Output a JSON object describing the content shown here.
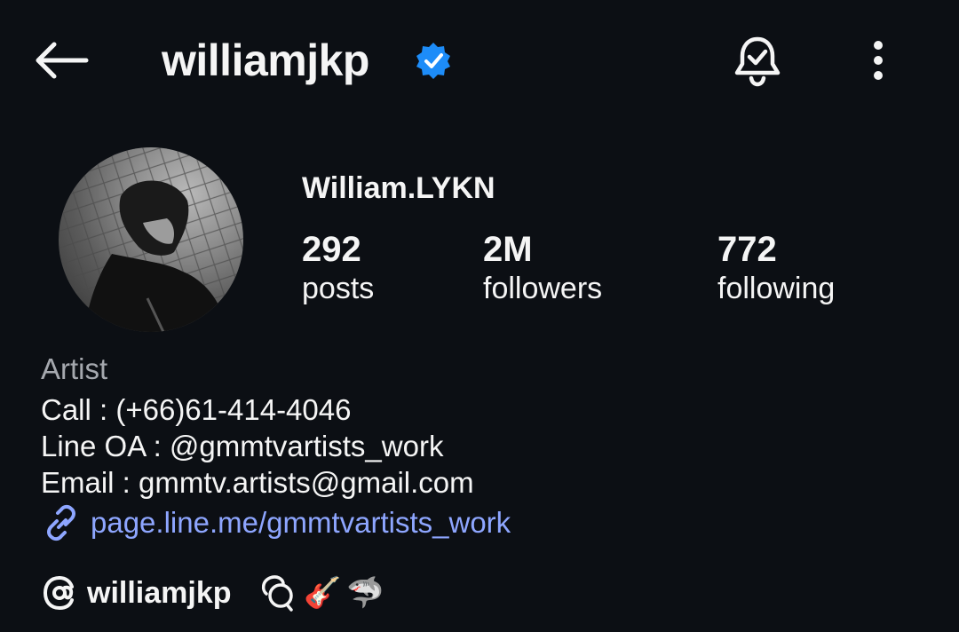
{
  "header": {
    "username": "williamjkp",
    "back_icon": "arrow-left-icon",
    "verified_icon": "verified-badge-icon",
    "notification_icon": "bell-check-icon",
    "menu_icon": "vertical-ellipsis-icon"
  },
  "profile": {
    "display_name": "William.LYKN",
    "stats": {
      "posts": {
        "value": "292",
        "label": "posts"
      },
      "followers": {
        "value": "2M",
        "label": "followers"
      },
      "following": {
        "value": "772",
        "label": "following"
      }
    }
  },
  "bio": {
    "category": "Artist",
    "lines": [
      "Call : (+66)61-414-4046",
      "Line OA : @gmmtvartists_work",
      "Email : gmmtv.artists@gmail.com"
    ],
    "link": "page.line.me/gmmtvartists_work"
  },
  "threads": {
    "username": "williamjkp",
    "emojis": [
      "🎸",
      "🦈"
    ]
  },
  "colors": {
    "background": "#0c0f14",
    "text": "#f5f5f5",
    "muted": "#a5a8ae",
    "link": "#8ea6ff",
    "verified": "#1d8cf8"
  }
}
